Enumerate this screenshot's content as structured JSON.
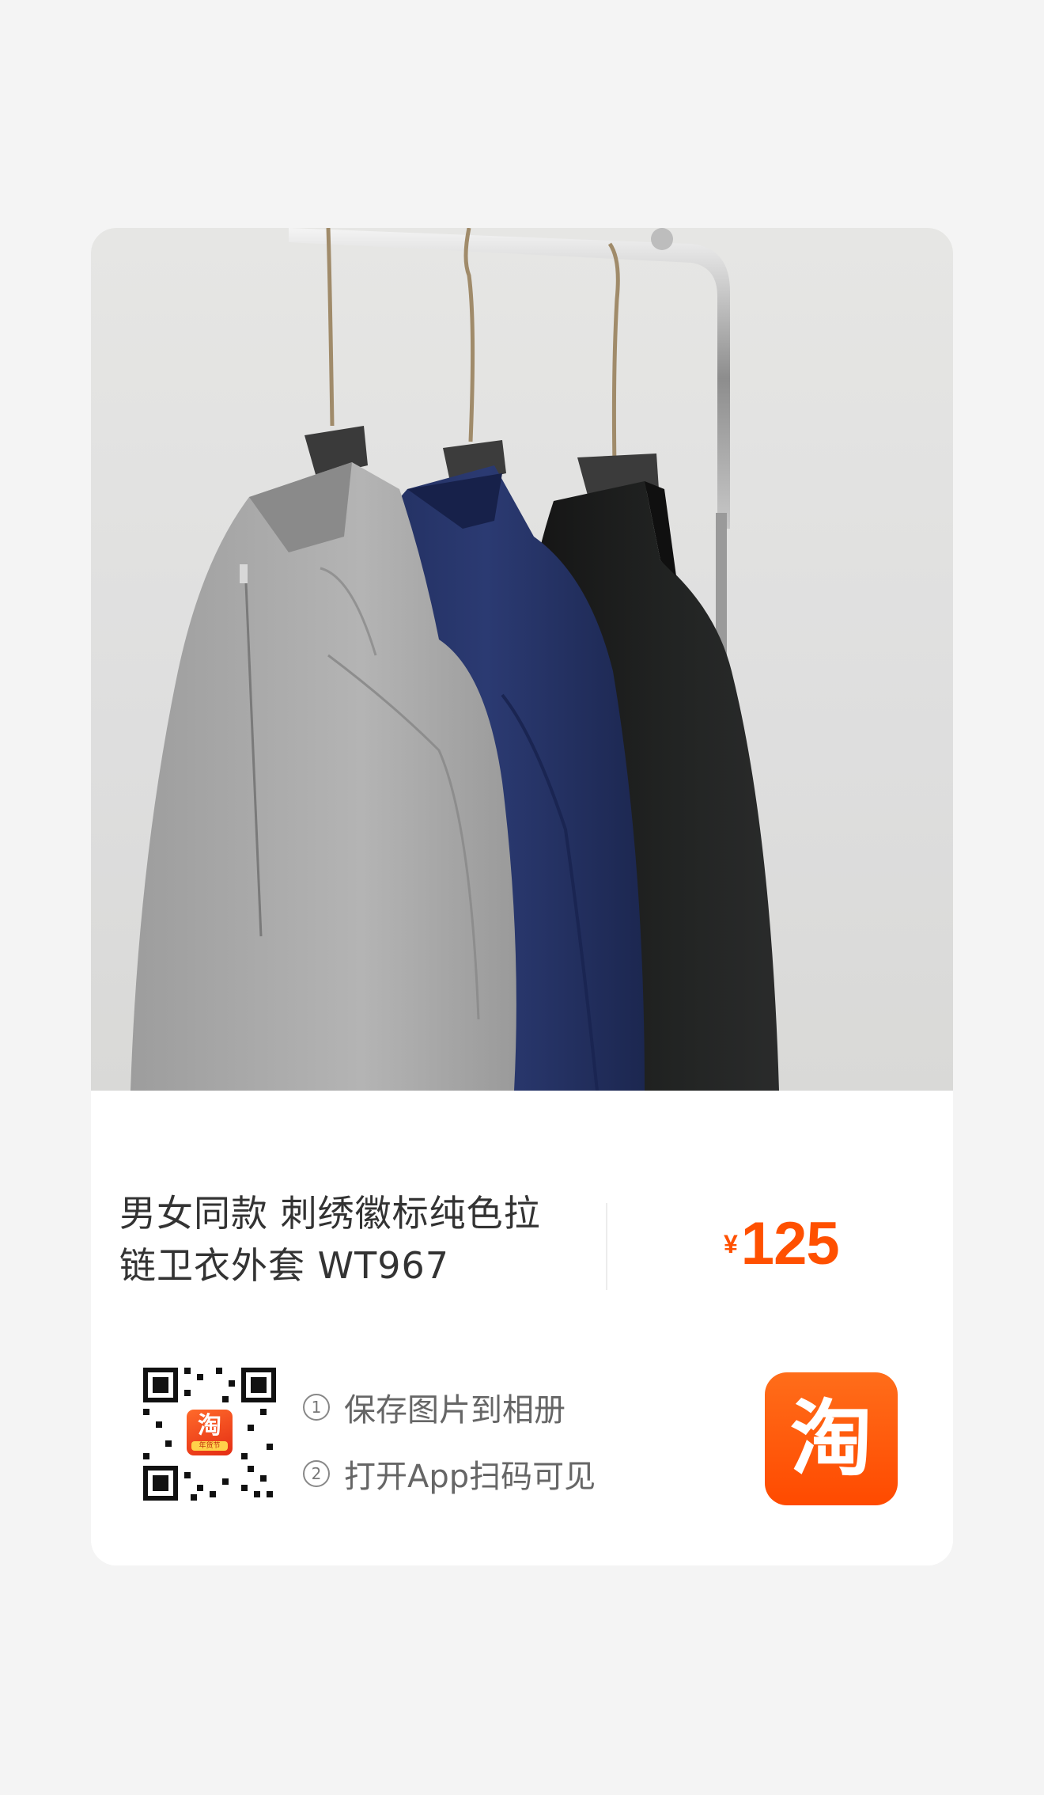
{
  "product": {
    "title": "男女同款 刺绣徽标纯色拉链卫衣外套 WT967",
    "price_currency": "¥",
    "price_amount": "125"
  },
  "qr": {
    "badge_glyph": "淘",
    "badge_sub": "年货节"
  },
  "steps": [
    {
      "num": "1",
      "text": "保存图片到相册"
    },
    {
      "num": "2",
      "text": "打开App扫码可见"
    }
  ],
  "app_icon": {
    "glyph": "淘"
  },
  "colors": {
    "price": "#ff5000",
    "taobao_orange": "#ff5000",
    "background": "#f4f4f4"
  }
}
